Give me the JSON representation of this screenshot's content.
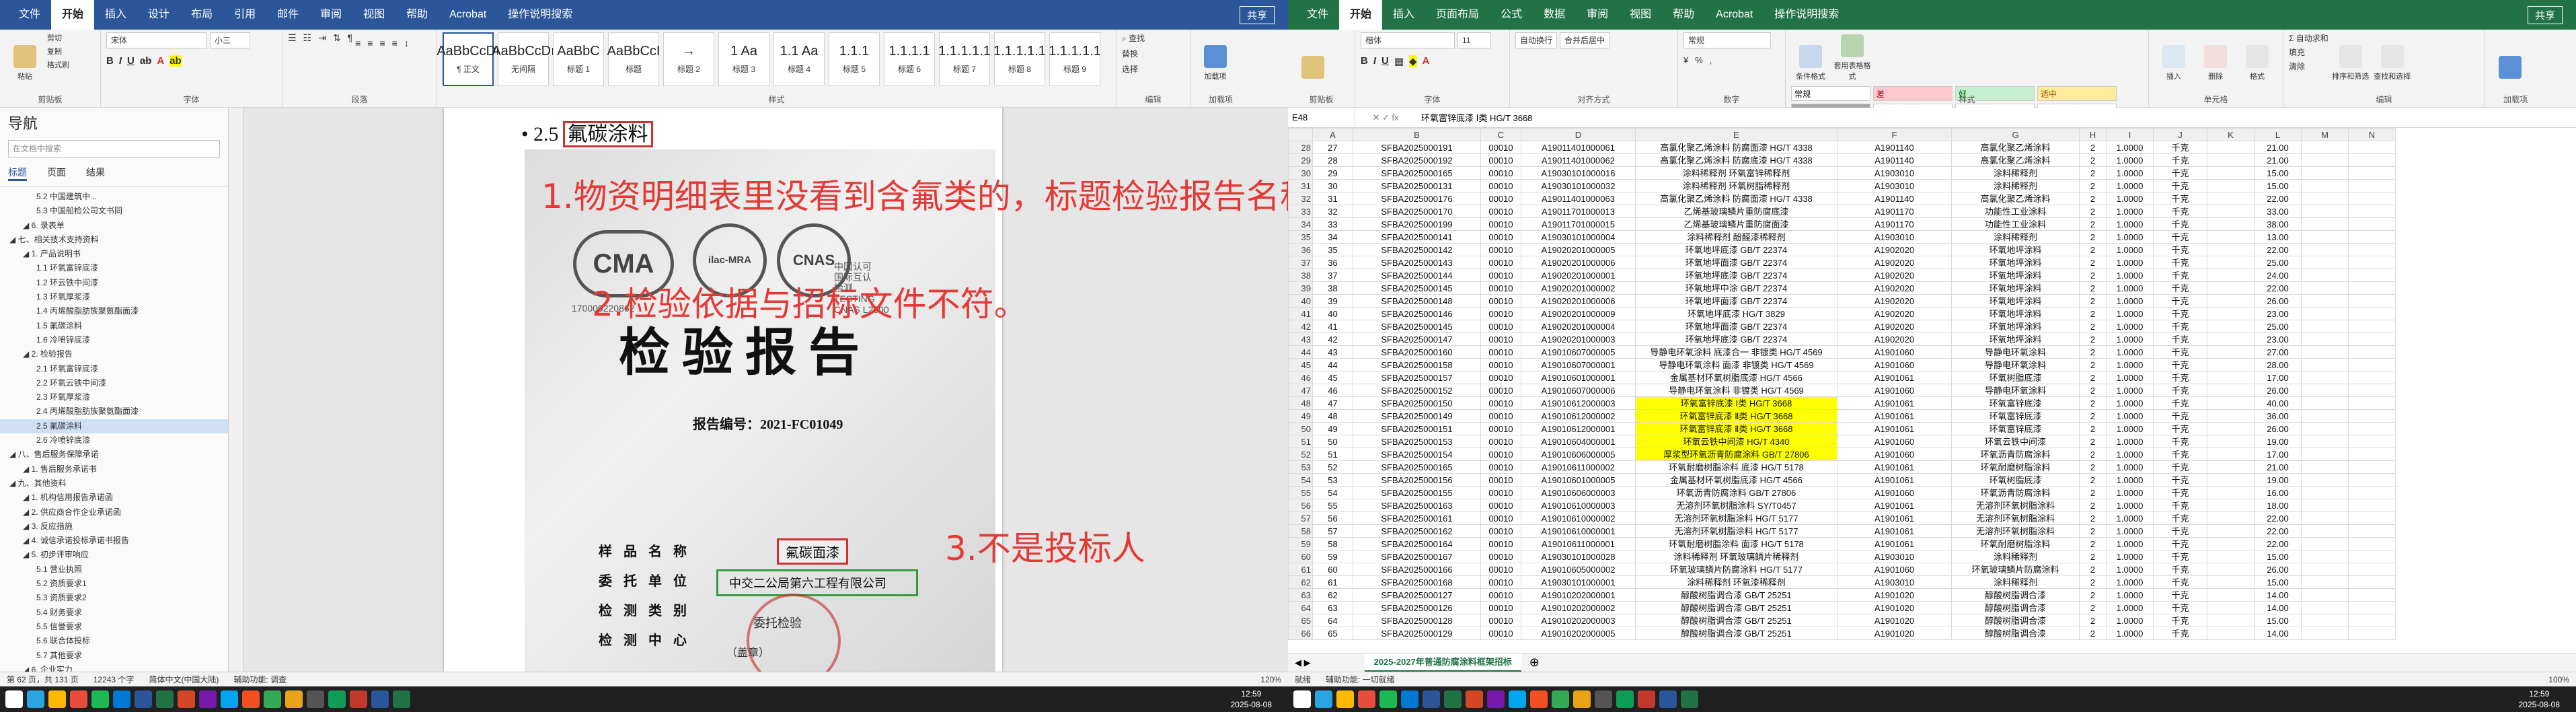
{
  "word": {
    "title_tabs": [
      "文件",
      "开始",
      "插入",
      "设计",
      "布局",
      "引用",
      "邮件",
      "审阅",
      "视图",
      "帮助",
      "Acrobat",
      "操作说明搜索"
    ],
    "active_tab": "开始",
    "share": "共享",
    "ribbon": {
      "clipboard": {
        "name": "剪贴板",
        "paste": "粘贴",
        "cut": "剪切",
        "copy": "复制",
        "painter": "格式刷"
      },
      "font": {
        "name": "字体",
        "font_value": "宋体",
        "size_value": "小三"
      },
      "paragraph": {
        "name": "段落"
      },
      "styles": {
        "name": "样式",
        "items": [
          {
            "sample": "AaBbCcDı",
            "label": "¶ 正文"
          },
          {
            "sample": "AaBbCcDı",
            "label": "无间隔"
          },
          {
            "sample": "AaBbC",
            "label": "标题 1"
          },
          {
            "sample": "AaBbCcI",
            "label": "标题"
          },
          {
            "sample": "→",
            "label": "标题 2"
          },
          {
            "sample": "1 Aa",
            "label": "标题 3"
          },
          {
            "sample": "1.1 Aa",
            "label": "标题 4"
          },
          {
            "sample": "1.1.1",
            "label": "标题 5"
          },
          {
            "sample": "1.1.1.1",
            "label": "标题 6"
          },
          {
            "sample": "1.1.1.1.1",
            "label": "标题 7"
          },
          {
            "sample": "1.1.1.1.1",
            "label": "标题 8"
          },
          {
            "sample": "1.1.1.1.1",
            "label": "标题 9"
          }
        ]
      },
      "editing": {
        "name": "编辑",
        "find": "查找",
        "replace": "替换",
        "select": "选择"
      },
      "addins": {
        "name": "加载项",
        "label": "加载项"
      }
    },
    "nav": {
      "title": "导航",
      "search_placeholder": "在文档中搜索",
      "tabs": [
        "标题",
        "页面",
        "结果"
      ],
      "items": [
        {
          "level": 3,
          "text": "5.2 中国建筑中..."
        },
        {
          "level": 3,
          "text": "5.3 中国船检公司文书同"
        },
        {
          "level": 2,
          "text": "6. 录表单"
        },
        {
          "level": 1,
          "text": "七、相关技术支持资料"
        },
        {
          "level": 2,
          "text": "1. 产品说明书"
        },
        {
          "level": 3,
          "text": "1.1 环氧富锌底漆"
        },
        {
          "level": 3,
          "text": "1.2 环云铁中间漆"
        },
        {
          "level": 3,
          "text": "1.3 环氧厚浆漆"
        },
        {
          "level": 3,
          "text": "1.4 丙烯酸脂肪族聚氨酯面漆"
        },
        {
          "level": 3,
          "text": "1.5 氟碳涂料"
        },
        {
          "level": 3,
          "text": "1.6 冷喷锌底漆"
        },
        {
          "level": 2,
          "text": "2. 检验报告"
        },
        {
          "level": 3,
          "text": "2.1 环氧富锌底漆"
        },
        {
          "level": 3,
          "text": "2.2 环氧云铁中间漆"
        },
        {
          "level": 3,
          "text": "2.3 环氧厚浆漆"
        },
        {
          "level": 3,
          "text": "2.4 丙烯酸脂肪族聚氨酯面漆"
        },
        {
          "level": 3,
          "text": "2.5 氟碳涂料"
        },
        {
          "level": 3,
          "text": "2.6 冷喷锌底漆"
        },
        {
          "level": 1,
          "text": "八、售后服务保障承诺"
        },
        {
          "level": 2,
          "text": "1. 售后服务承诺书"
        },
        {
          "level": 1,
          "text": "九、其他资料"
        },
        {
          "level": 2,
          "text": "1. 机构信用报告承诺函"
        },
        {
          "level": 2,
          "text": "2. 供应商合作企业承诺函"
        },
        {
          "level": 2,
          "text": "3. 反应措施"
        },
        {
          "level": 2,
          "text": "4. 诚信承诺投标承诺书报告"
        },
        {
          "level": 2,
          "text": "5. 初步评审响应"
        },
        {
          "level": 3,
          "text": "5.1 营业执照"
        },
        {
          "level": 3,
          "text": "5.2 资质要求1"
        },
        {
          "level": 3,
          "text": "5.3 资质要求2"
        },
        {
          "level": 3,
          "text": "5.4 财务要求"
        },
        {
          "level": 3,
          "text": "5.5 信誉要求"
        },
        {
          "level": 3,
          "text": "5.6 联合体投标"
        },
        {
          "level": 3,
          "text": "5.7 其他要求"
        },
        {
          "level": 2,
          "text": "6. 企业实力"
        },
        {
          "level": 3,
          "text": "6.1 ..."
        }
      ],
      "selected": "2.5 氟碳涂料"
    },
    "doc": {
      "heading_num": "2.5",
      "heading_text": "氟碳涂料",
      "report_title": "检验报告",
      "report_no": "报告编号：2021-FC01049",
      "cert_no": "170000220862",
      "cnas_lines": [
        "中国认可",
        "国际互认",
        "检测",
        "TESTING",
        "CNAS L2600"
      ],
      "logo_cma": "CMA",
      "logo_ilac": "ilac-MRA",
      "logo_cnas": "CNAS",
      "field_labels": [
        "样 品 名 称",
        "委 托 单 位",
        "检 测 类 别",
        "检 测 中 心"
      ],
      "sample_name": "氟碳面漆",
      "client": "中交二公局第六工程有限公司",
      "category": "委托检验",
      "seal": "（盖章）"
    },
    "annotations": [
      "1.物资明细表里没看到含氟类的，标题检验报告名称不一致，一个是涂料一个是漆。",
      "2.检验依据与招标文件不符。",
      "3.不是投标人"
    ],
    "status": {
      "page": "第 62 页，共 131 页",
      "words": "12243 个字",
      "lang": "简体中文(中国大陆)",
      "focus": "辅助功能: 调查",
      "zoom": "120%"
    }
  },
  "excel": {
    "title_tabs": [
      "文件",
      "开始",
      "插入",
      "页面布局",
      "公式",
      "数据",
      "审阅",
      "视图",
      "帮助",
      "Acrobat",
      "操作说明搜索"
    ],
    "active_tab": "开始",
    "share": "共享",
    "ribbon": {
      "clipboard": "剪贴板",
      "font": "字体",
      "alignment": "对齐方式",
      "number": "数字",
      "styles": "样式",
      "cells": "单元格",
      "editing": "编辑",
      "addins": "加载项",
      "font_value": "楷体",
      "size_value": "11",
      "wrap": "自动换行",
      "merge": "合并后居中",
      "number_format": "常规",
      "cond_format": "条件格式",
      "table_format": "套用表格格式",
      "insert": "插入",
      "delete": "删除",
      "format": "格式",
      "autosum": "自动求和",
      "fill": "填充",
      "clear": "清除",
      "sort": "排序和筛选",
      "find": "查找和选择",
      "cell_styles": [
        {
          "label": "常规",
          "bg": "#ffffff",
          "fg": "#000000"
        },
        {
          "label": "差",
          "bg": "#ffc7ce",
          "fg": "#9c0006"
        },
        {
          "label": "好",
          "bg": "#c6efce",
          "fg": "#006100"
        },
        {
          "label": "适中",
          "bg": "#ffeb9c",
          "fg": "#9c5700"
        },
        {
          "label": "检查单元格",
          "bg": "#a5a5a5",
          "fg": "#ffffff"
        },
        {
          "label": "解释性文本",
          "bg": "#ffffff",
          "fg": "#7f7f7f"
        },
        {
          "label": "警告文本",
          "bg": "#ffffff",
          "fg": "#ff0000"
        },
        {
          "label": "链接单元格",
          "bg": "#ffffff",
          "fg": "#fa7d00"
        }
      ]
    },
    "name_box": "E48",
    "formula": "环氧富锌底漆 Ⅰ类 HG/T 3668",
    "columns": [
      "",
      "A",
      "B",
      "C",
      "D",
      "E",
      "F",
      "G",
      "H",
      "I",
      "J",
      "K",
      "L",
      "M",
      "N"
    ],
    "rows": [
      {
        "r": "28",
        "a": "27",
        "b": "SFBA2025000191",
        "c": "00010",
        "d": "A19011401000061",
        "e": "高氯化聚乙烯涂料 防腐面漆 HG/T 4338",
        "f": "A1901140",
        "g": "高氯化聚乙烯涂料",
        "h": "2",
        "i": "1.0000",
        "j": "千克",
        "l": "21.00"
      },
      {
        "r": "29",
        "a": "28",
        "b": "SFBA2025000192",
        "c": "00010",
        "d": "A19011401000062",
        "e": "高氯化聚乙烯涂料 防腐底漆 HG/T 4338",
        "f": "A1901140",
        "g": "高氯化聚乙烯涂料",
        "h": "2",
        "i": "1.0000",
        "j": "千克",
        "l": "21.00"
      },
      {
        "r": "30",
        "a": "29",
        "b": "SFBA2025000165",
        "c": "00010",
        "d": "A19030101000016",
        "e": "涂料稀释剂 环氧富锌稀释剂",
        "f": "A1903010",
        "g": "涂料稀释剂",
        "h": "2",
        "i": "1.0000",
        "j": "千克",
        "l": "15.00"
      },
      {
        "r": "31",
        "a": "30",
        "b": "SFBA2025000131",
        "c": "00010",
        "d": "A19030101000032",
        "e": "涂料稀释剂 环氧树脂稀释剂",
        "f": "A1903010",
        "g": "涂料稀释剂",
        "h": "2",
        "i": "1.0000",
        "j": "千克",
        "l": "15.00"
      },
      {
        "r": "32",
        "a": "31",
        "b": "SFBA2025000176",
        "c": "00010",
        "d": "A19011401000063",
        "e": "高氯化聚乙烯涂料 防腐面漆 HG/T 4338",
        "f": "A1901140",
        "g": "高氯化聚乙烯涂料",
        "h": "2",
        "i": "1.0000",
        "j": "千克",
        "l": "22.00"
      },
      {
        "r": "33",
        "a": "32",
        "b": "SFBA2025000170",
        "c": "00010",
        "d": "A19011701000013",
        "e": "乙烯基玻璃鳞片重防腐底漆",
        "f": "A1901170",
        "g": "功能性工业涂料",
        "h": "2",
        "i": "1.0000",
        "j": "千克",
        "l": "33.00"
      },
      {
        "r": "34",
        "a": "33",
        "b": "SFBA2025000199",
        "c": "00010",
        "d": "A19011701000015",
        "e": "乙烯基玻璃鳞片重防腐面漆",
        "f": "A1901170",
        "g": "功能性工业涂料",
        "h": "2",
        "i": "1.0000",
        "j": "千克",
        "l": "38.00"
      },
      {
        "r": "35",
        "a": "34",
        "b": "SFBA2025000141",
        "c": "00010",
        "d": "A19030101000004",
        "e": "涂料稀释剂 酚醛漆稀释剂",
        "f": "A1903010",
        "g": "涂料稀释剂",
        "h": "2",
        "i": "1.0000",
        "j": "千克",
        "l": "13.00"
      },
      {
        "r": "36",
        "a": "35",
        "b": "SFBA2025000142",
        "c": "00010",
        "d": "A19020201000005",
        "e": "环氧地坪底漆 GB/T 22374",
        "f": "A1902020",
        "g": "环氧地坪涂料",
        "h": "2",
        "i": "1.0000",
        "j": "千克",
        "l": "22.00"
      },
      {
        "r": "37",
        "a": "36",
        "b": "SFBA2025000143",
        "c": "00010",
        "d": "A19020201000006",
        "e": "环氧地坪面漆 GB/T 22374",
        "f": "A1902020",
        "g": "环氧地坪涂料",
        "h": "2",
        "i": "1.0000",
        "j": "千克",
        "l": "25.00"
      },
      {
        "r": "38",
        "a": "37",
        "b": "SFBA2025000144",
        "c": "00010",
        "d": "A19020201000001",
        "e": "环氧地坪底漆 GB/T 22374",
        "f": "A1902020",
        "g": "环氧地坪涂料",
        "h": "2",
        "i": "1.0000",
        "j": "千克",
        "l": "24.00"
      },
      {
        "r": "39",
        "a": "38",
        "b": "SFBA2025000145",
        "c": "00010",
        "d": "A19020201000002",
        "e": "环氧地坪中涂 GB/T 22374",
        "f": "A1902020",
        "g": "环氧地坪涂料",
        "h": "2",
        "i": "1.0000",
        "j": "千克",
        "l": "22.00"
      },
      {
        "r": "40",
        "a": "39",
        "b": "SFBA2025000148",
        "c": "00010",
        "d": "A19020201000006",
        "e": "环氧地坪面漆 GB/T 22374",
        "f": "A1902020",
        "g": "环氧地坪涂料",
        "h": "2",
        "i": "1.0000",
        "j": "千克",
        "l": "26.00"
      },
      {
        "r": "41",
        "a": "40",
        "b": "SFBA2025000146",
        "c": "00010",
        "d": "A19020201000009",
        "e": "环氧地坪底漆 HG/T 3829",
        "f": "A1902020",
        "g": "环氧地坪涂料",
        "h": "2",
        "i": "1.0000",
        "j": "千克",
        "l": "23.00"
      },
      {
        "r": "42",
        "a": "41",
        "b": "SFBA2025000145",
        "c": "00010",
        "d": "A19020201000004",
        "e": "环氧地坪面漆 GB/T 22374",
        "f": "A1902020",
        "g": "环氧地坪涂料",
        "h": "2",
        "i": "1.0000",
        "j": "千克",
        "l": "25.00"
      },
      {
        "r": "43",
        "a": "42",
        "b": "SFBA2025000147",
        "c": "00010",
        "d": "A19020201000003",
        "e": "环氧地坪底漆 GB/T 22374",
        "f": "A1902020",
        "g": "环氧地坪涂料",
        "h": "2",
        "i": "1.0000",
        "j": "千克",
        "l": "23.00"
      },
      {
        "r": "44",
        "a": "43",
        "b": "SFBA2025000160",
        "c": "00010",
        "d": "A19010607000005",
        "e": "导静电环氧涂料 底漆合一 非镀类 HG/T 4569",
        "f": "A1901060",
        "g": "导静电环氧涂料",
        "h": "2",
        "i": "1.0000",
        "j": "千克",
        "l": "27.00"
      },
      {
        "r": "45",
        "a": "44",
        "b": "SFBA2025000158",
        "c": "00010",
        "d": "A19010607000001",
        "e": "导静电环氧涂料 面漆 非镀类 HG/T 4569",
        "f": "A1901060",
        "g": "导静电环氧涂料",
        "h": "2",
        "i": "1.0000",
        "j": "千克",
        "l": "28.00"
      },
      {
        "r": "46",
        "a": "45",
        "b": "SFBA2025000157",
        "c": "00010",
        "d": "A19010601000001",
        "e": "金属基材环氧树脂底漆 HG/T 4566",
        "f": "A1901061",
        "g": "环氧树脂底漆",
        "h": "2",
        "i": "1.0000",
        "j": "千克",
        "l": "17.00"
      },
      {
        "r": "47",
        "a": "46",
        "b": "SFBA2025000152",
        "c": "00010",
        "d": "A19010607000006",
        "e": "导静电环氧涂料 非镀类 HG/T 4569",
        "f": "A1901060",
        "g": "导静电环氧涂料",
        "h": "2",
        "i": "1.0000",
        "j": "千克",
        "l": "26.00"
      },
      {
        "r": "48",
        "a": "47",
        "b": "SFBA2025000150",
        "c": "00010",
        "d": "A19010612000003",
        "e": "环氧富锌底漆 Ⅰ类 HG/T 3668",
        "f": "A1901061",
        "g": "环氧富锌底漆",
        "h": "2",
        "i": "1.0000",
        "j": "千克",
        "l": "40.00",
        "hl": true
      },
      {
        "r": "49",
        "a": "48",
        "b": "SFBA2025000149",
        "c": "00010",
        "d": "A19010612000002",
        "e": "环氧富锌底漆 Ⅱ类 HG/T 3668",
        "f": "A1901061",
        "g": "环氧富锌底漆",
        "h": "2",
        "i": "1.0000",
        "j": "千克",
        "l": "36.00",
        "hl": true
      },
      {
        "r": "50",
        "a": "49",
        "b": "SFBA2025000151",
        "c": "00010",
        "d": "A19010612000001",
        "e": "环氧富锌底漆 Ⅱ类 HG/T 3668",
        "f": "A1901061",
        "g": "环氧富锌底漆",
        "h": "2",
        "i": "1.0000",
        "j": "千克",
        "l": "26.00",
        "hl": true
      },
      {
        "r": "51",
        "a": "50",
        "b": "SFBA2025000153",
        "c": "00010",
        "d": "A19010604000001",
        "e": "环氧云铁中间漆 HG/T 4340",
        "f": "A1901060",
        "g": "环氧云铁中间漆",
        "h": "2",
        "i": "1.0000",
        "j": "千克",
        "l": "19.00",
        "hl": true
      },
      {
        "r": "52",
        "a": "51",
        "b": "SFBA2025000154",
        "c": "00010",
        "d": "A19010606000005",
        "e": "厚浆型环氧沥青防腐涂料 GB/T 27806",
        "f": "A1901060",
        "g": "环氧沥青防腐涂料",
        "h": "2",
        "i": "1.0000",
        "j": "千克",
        "l": "17.00",
        "hl": true
      },
      {
        "r": "53",
        "a": "52",
        "b": "SFBA2025000165",
        "c": "00010",
        "d": "A19010611000002",
        "e": "环氧耐磨树脂涂料 底漆 HG/T 5178",
        "f": "A1901061",
        "g": "环氧耐磨树脂涂料",
        "h": "2",
        "i": "1.0000",
        "j": "千克",
        "l": "21.00"
      },
      {
        "r": "54",
        "a": "53",
        "b": "SFBA2025000156",
        "c": "00010",
        "d": "A19010601000005",
        "e": "金属基材环氧树脂底漆 HG/T 4566",
        "f": "A1901061",
        "g": "环氧树脂底漆",
        "h": "2",
        "i": "1.0000",
        "j": "千克",
        "l": "19.00"
      },
      {
        "r": "55",
        "a": "54",
        "b": "SFBA2025000155",
        "c": "00010",
        "d": "A19010606000003",
        "e": "环氧沥青防腐涂料 GB/T 27806",
        "f": "A1901060",
        "g": "环氧沥青防腐涂料",
        "h": "2",
        "i": "1.0000",
        "j": "千克",
        "l": "16.00"
      },
      {
        "r": "56",
        "a": "55",
        "b": "SFBA2025000163",
        "c": "00010",
        "d": "A19010610000003",
        "e": "无溶剂环氧树脂涂料 SY/T0457",
        "f": "A1901061",
        "g": "无溶剂环氧树脂涂料",
        "h": "2",
        "i": "1.0000",
        "j": "千克",
        "l": "18.00"
      },
      {
        "r": "57",
        "a": "56",
        "b": "SFBA2025000161",
        "c": "00010",
        "d": "A19010610000002",
        "e": "无溶剂环氧树脂涂料 HG/T 5177",
        "f": "A1901061",
        "g": "无溶剂环氧树脂涂料",
        "h": "2",
        "i": "1.0000",
        "j": "千克",
        "l": "22.00"
      },
      {
        "r": "58",
        "a": "57",
        "b": "SFBA2025000162",
        "c": "00010",
        "d": "A19010610000001",
        "e": "无溶剂环氧树脂涂料 HG/T 5177",
        "f": "A1901061",
        "g": "无溶剂环氧树脂涂料",
        "h": "2",
        "i": "1.0000",
        "j": "千克",
        "l": "22.00"
      },
      {
        "r": "59",
        "a": "58",
        "b": "SFBA2025000164",
        "c": "00010",
        "d": "A19010611000001",
        "e": "环氧耐磨树脂涂料 面漆 HG/T 5178",
        "f": "A1901061",
        "g": "环氧耐磨树脂涂料",
        "h": "2",
        "i": "1.0000",
        "j": "千克",
        "l": "22.00"
      },
      {
        "r": "60",
        "a": "59",
        "b": "SFBA2025000167",
        "c": "00010",
        "d": "A19030101000028",
        "e": "涂料稀释剂 环氧玻璃鳞片稀释剂",
        "f": "A1903010",
        "g": "涂料稀释剂",
        "h": "2",
        "i": "1.0000",
        "j": "千克",
        "l": "15.00"
      },
      {
        "r": "61",
        "a": "60",
        "b": "SFBA2025000166",
        "c": "00010",
        "d": "A19010605000002",
        "e": "环氧玻璃鳞片防腐涂料 HG/T 5177",
        "f": "A1901060",
        "g": "环氧玻璃鳞片防腐涂料",
        "h": "2",
        "i": "1.0000",
        "j": "千克",
        "l": "26.00"
      },
      {
        "r": "62",
        "a": "61",
        "b": "SFBA2025000168",
        "c": "00010",
        "d": "A19030101000001",
        "e": "涂料稀释剂 环氧漆稀释剂",
        "f": "A1903010",
        "g": "涂料稀释剂",
        "h": "2",
        "i": "1.0000",
        "j": "千克",
        "l": "15.00"
      },
      {
        "r": "63",
        "a": "62",
        "b": "SFBA2025000127",
        "c": "00010",
        "d": "A19010202000001",
        "e": "醇酸树脂调合漆 GB/T 25251",
        "f": "A1901020",
        "g": "醇酸树脂调合漆",
        "h": "2",
        "i": "1.0000",
        "j": "千克",
        "l": "14.00"
      },
      {
        "r": "64",
        "a": "63",
        "b": "SFBA2025000126",
        "c": "00010",
        "d": "A19010202000002",
        "e": "醇酸树脂调合漆 GB/T 25251",
        "f": "A1901020",
        "g": "醇酸树脂调合漆",
        "h": "2",
        "i": "1.0000",
        "j": "千克",
        "l": "14.00"
      },
      {
        "r": "65",
        "a": "64",
        "b": "SFBA2025000128",
        "c": "00010",
        "d": "A19010202000003",
        "e": "醇酸树脂调合漆 GB/T 25251",
        "f": "A1901020",
        "g": "醇酸树脂调合漆",
        "h": "2",
        "i": "1.0000",
        "j": "千克",
        "l": "15.00"
      },
      {
        "r": "66",
        "a": "65",
        "b": "SFBA2025000129",
        "c": "00010",
        "d": "A19010202000005",
        "e": "醇酸树脂调合漆 GB/T 25251",
        "f": "A1901020",
        "g": "醇酸树脂调合漆",
        "h": "2",
        "i": "1.0000",
        "j": "千克",
        "l": "14.00"
      }
    ],
    "sheet_tab": "2025-2027年普通防腐涂料框架招标",
    "status": {
      "mode": "就绪",
      "access": "辅助功能: 一切就绪",
      "zoom": "100%"
    }
  },
  "taskbar": {
    "left_time": "12:59",
    "left_date": "2025-08-08",
    "right_time": "12:59",
    "right_date": "2025-08-08"
  }
}
